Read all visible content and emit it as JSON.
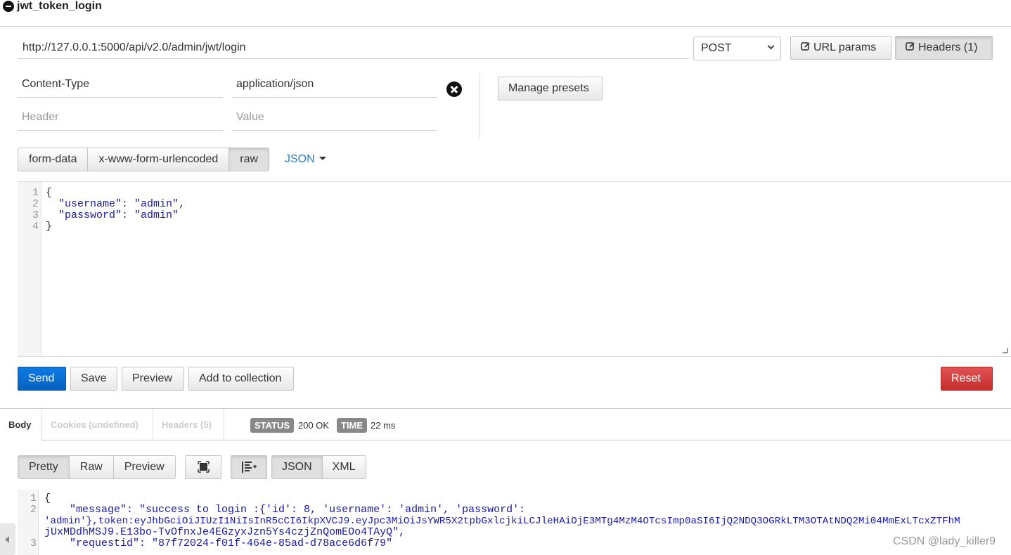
{
  "request": {
    "title": "jwt_token_login",
    "url": "http://127.0.0.1:5000/api/v2.0/admin/jwt/login",
    "method": "POST",
    "url_params_label": "URL params",
    "headers_label": "Headers (1)"
  },
  "headers": {
    "rows": [
      {
        "key": "Content-Type",
        "value": "application/json"
      }
    ],
    "key_placeholder": "Header",
    "value_placeholder": "Value",
    "manage_presets_label": "Manage presets"
  },
  "body_tabs": [
    "form-data",
    "x-www-form-urlencoded",
    "raw"
  ],
  "body_format": "JSON",
  "request_body": {
    "line_numbers": [
      "1",
      "2",
      "3",
      "4"
    ],
    "lines": [
      {
        "prefix": "{",
        "key": "",
        "sep": "",
        "val": "",
        "suffix": ""
      },
      {
        "prefix": "  ",
        "key": "\"username\"",
        "sep": ": ",
        "val": "\"admin\"",
        "suffix": ","
      },
      {
        "prefix": "  ",
        "key": "\"password\"",
        "sep": ": ",
        "val": "\"admin\"",
        "suffix": ""
      },
      {
        "prefix": "}",
        "key": "",
        "sep": "",
        "val": "",
        "suffix": ""
      }
    ]
  },
  "actions": {
    "send": "Send",
    "save": "Save",
    "preview": "Preview",
    "add_to_collection": "Add to collection",
    "reset": "Reset"
  },
  "response": {
    "tabs": [
      "Body",
      "Cookies (undefined)",
      "Headers (5)"
    ],
    "status_label": "STATUS",
    "status_value": "200 OK",
    "time_label": "TIME",
    "time_value": "22 ms",
    "view_tabs": [
      "Pretty",
      "Raw",
      "Preview"
    ],
    "format_tabs": [
      "JSON",
      "XML"
    ],
    "line_numbers": [
      "1",
      "2",
      "",
      "",
      "3"
    ],
    "body_lines": [
      "{",
      "    \"message\": \"success to login :{'id': 8, 'username': 'admin', 'password':",
      "'admin'},token:eyJhbGciOiJIUzI1NiIsInR5cCI6IkpXVCJ9.eyJpc3MiOiJsYWR5X2tpbGxlcjkiLCJleHAiOjE3MTg4MzM4OTcsImp0aSI6IjQ2NDQ3OGRkLTM3OTAtNDQ2Mi04MmExLTcxZTFhM",
      "jUxMDdhMSJ9.E13bo-TvOfnxJe4EGzyxJzn5Ys4czjZnQomEOo4TAyQ\",",
      "    \"requestid\": \"87f72024-f01f-464e-85ad-d78ace6d6f79\""
    ]
  },
  "watermark": "CSDN @lady_killer9",
  "icons": {
    "title": "minus-circle-icon",
    "edit": "edit-icon",
    "remove": "close-circle-icon",
    "fullscreen": "fullscreen-icon",
    "wrap": "wrap-lines-icon"
  }
}
